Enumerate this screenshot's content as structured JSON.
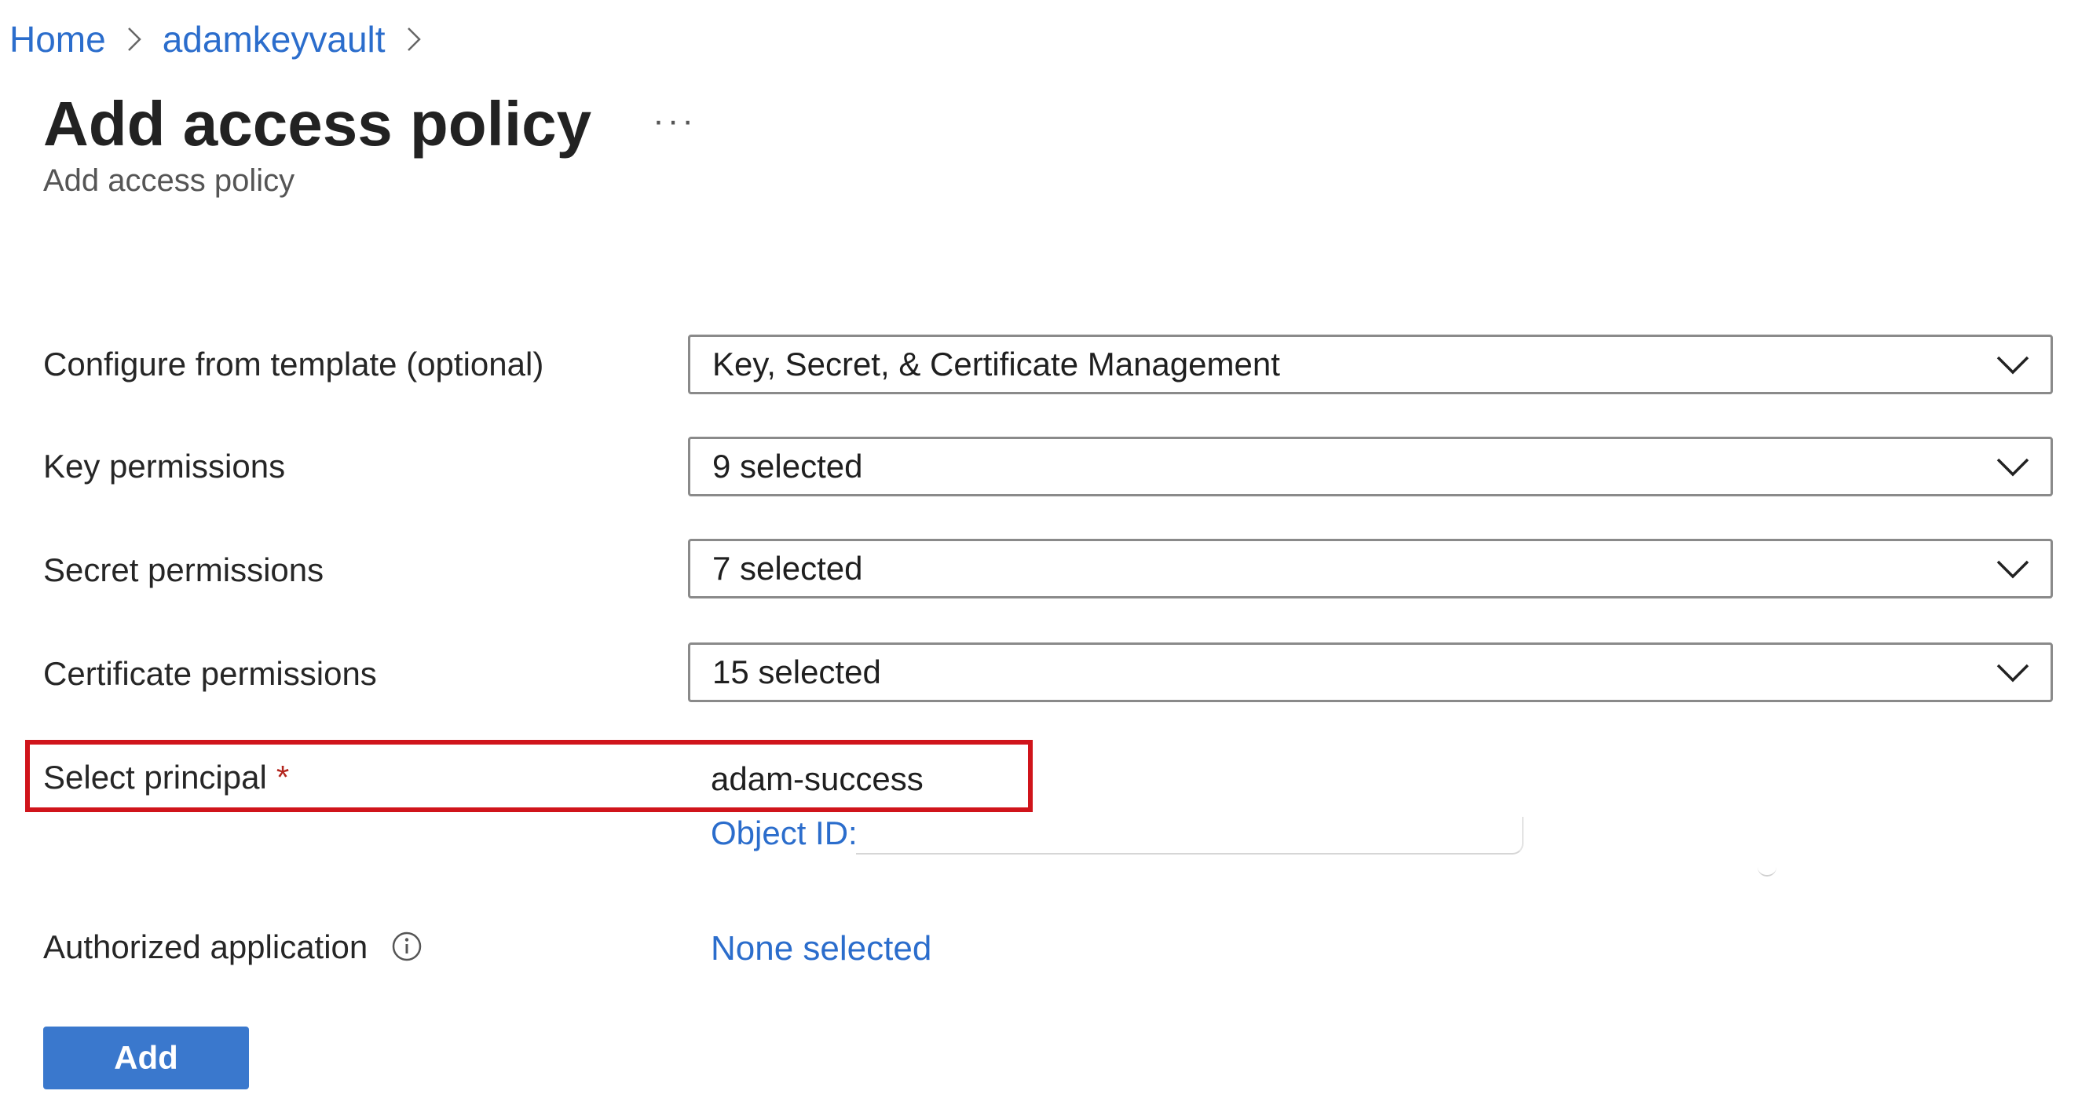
{
  "breadcrumb": {
    "items": [
      {
        "label": "Home"
      },
      {
        "label": "adamkeyvault"
      }
    ]
  },
  "header": {
    "title": "Add access policy",
    "more_label": "···",
    "subtitle": "Add access policy"
  },
  "form": {
    "template": {
      "label": "Configure from template (optional)",
      "value": "Key, Secret, & Certificate Management"
    },
    "key_permissions": {
      "label": "Key permissions",
      "value": "9 selected"
    },
    "secret_permissions": {
      "label": "Secret permissions",
      "value": "7 selected"
    },
    "certificate_permissions": {
      "label": "Certificate permissions",
      "value": "15 selected"
    },
    "principal": {
      "label": "Select principal",
      "required_marker": "*",
      "value": "adam-success",
      "object_id_label": "Object ID:"
    },
    "authorized_application": {
      "label": "Authorized application",
      "value": "None selected"
    }
  },
  "actions": {
    "add_label": "Add"
  },
  "icons": {
    "breadcrumb_separator": "chevron-right-icon",
    "dropdown": "chevron-down-icon",
    "info": "info-icon"
  },
  "colors": {
    "link": "#2b6dcc",
    "primary_button": "#3a78cd",
    "highlight": "#d0141b",
    "required": "#b3261e"
  }
}
